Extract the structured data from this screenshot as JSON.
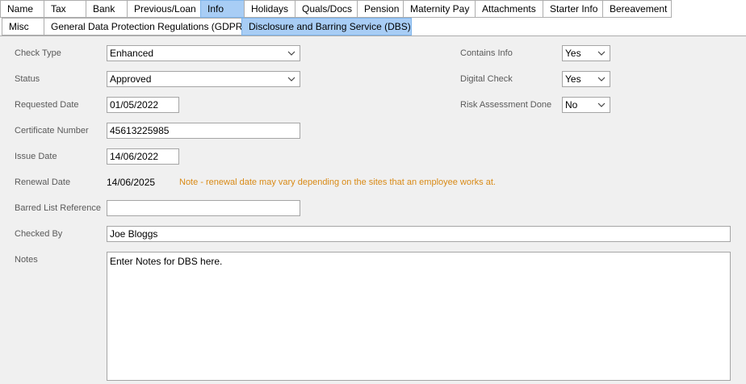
{
  "tabs_top": [
    {
      "label": "Name"
    },
    {
      "label": "Tax"
    },
    {
      "label": "Bank"
    },
    {
      "label": "Previous/Loan"
    },
    {
      "label": "Info"
    },
    {
      "label": "Holidays"
    },
    {
      "label": "Quals/Docs"
    },
    {
      "label": "Pension"
    },
    {
      "label": "Maternity Pay"
    },
    {
      "label": "Attachments"
    },
    {
      "label": "Starter Info"
    },
    {
      "label": "Bereavement"
    }
  ],
  "tabs_sub": [
    {
      "label": "Misc"
    },
    {
      "label": "General Data Protection Regulations (GDPR)"
    },
    {
      "label": "Disclosure and Barring Service (DBS)"
    }
  ],
  "form": {
    "check_type_label": "Check Type",
    "check_type_value": "Enhanced",
    "status_label": "Status",
    "status_value": "Approved",
    "requested_date_label": "Requested Date",
    "requested_date_value": "01/05/2022",
    "certificate_number_label": "Certificate Number",
    "certificate_number_value": "45613225985",
    "issue_date_label": "Issue Date",
    "issue_date_value": "14/06/2022",
    "renewal_date_label": "Renewal Date",
    "renewal_date_value": "14/06/2025",
    "renewal_note": "Note - renewal date may vary depending on the sites that an employee works at.",
    "barred_list_label": "Barred List Reference",
    "barred_list_value": "",
    "checked_by_label": "Checked By",
    "checked_by_value": "Joe Bloggs",
    "notes_label": "Notes",
    "notes_value": "Enter Notes for DBS here.",
    "contains_info_label": "Contains Info",
    "contains_info_value": "Yes",
    "digital_check_label": "Digital Check",
    "digital_check_value": "Yes",
    "risk_assessment_label": "Risk Assessment Done",
    "risk_assessment_value": "No"
  },
  "colors": {
    "active_tab": "#a8cdf5",
    "panel_bg": "#f0f0f0",
    "note_text": "#d98a16"
  }
}
